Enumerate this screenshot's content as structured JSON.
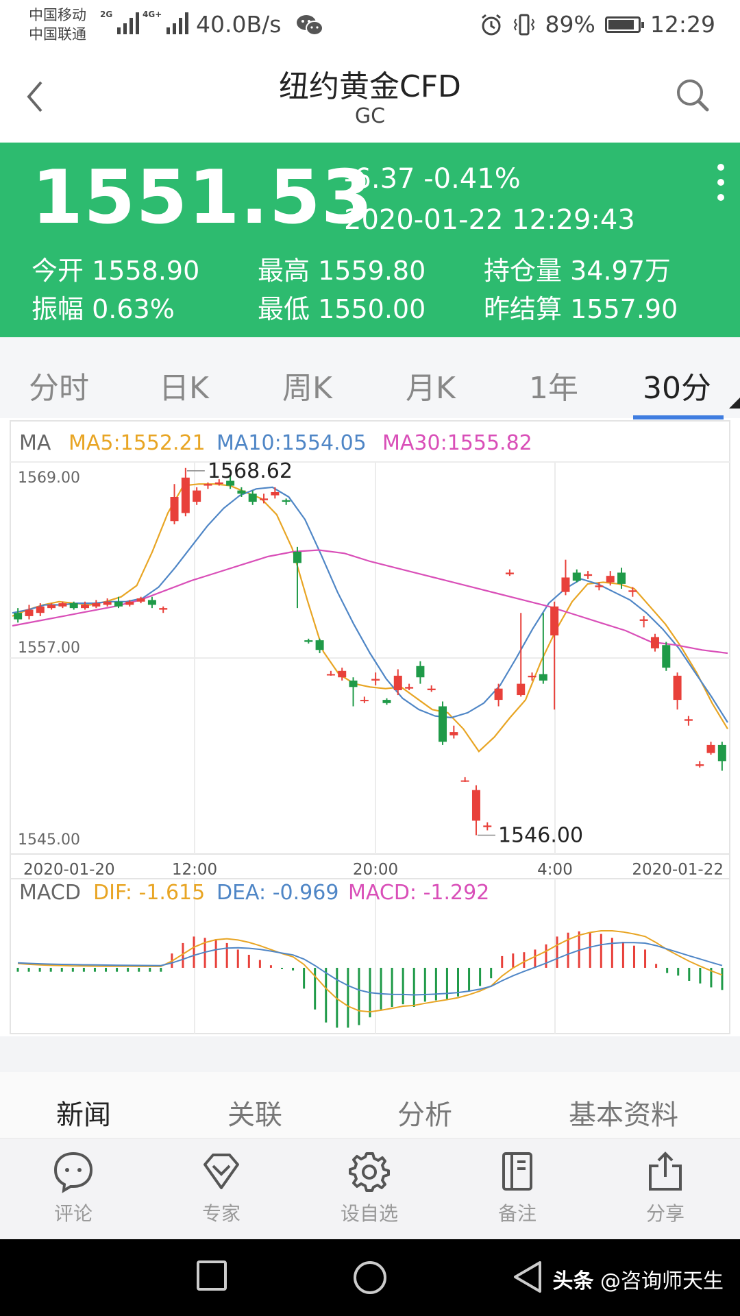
{
  "status_bar": {
    "carrier_1": "中国移动",
    "carrier_2": "中国联通",
    "signal_1_tag": "2G",
    "signal_2_tag": "4G+",
    "net_speed": "40.0B/s",
    "battery": "89%",
    "time": "12:29",
    "icons": [
      "wechat-icon",
      "alarm-icon",
      "vibrate-icon",
      "battery-icon"
    ]
  },
  "header": {
    "title": "纽约黄金CFD",
    "symbol": "GC",
    "icons": [
      "back-arrow-icon",
      "search-icon"
    ]
  },
  "quote": {
    "price": "1551.53",
    "change": "-6.37 -0.41%",
    "datetime": "2020-01-22 12:29:43",
    "background": "#2dbb6f",
    "stats": [
      {
        "label": "今开",
        "value": "1558.90"
      },
      {
        "label": "最高",
        "value": "1559.80"
      },
      {
        "label": "持仓量",
        "value": "34.97万"
      },
      {
        "label": "振幅",
        "value": "0.63%"
      },
      {
        "label": "最低",
        "value": "1550.00"
      },
      {
        "label": "昨结算",
        "value": "1557.90"
      }
    ]
  },
  "period_tabs": {
    "items": [
      "分时",
      "日K",
      "周K",
      "月K",
      "1年",
      "30分"
    ],
    "active": "30分",
    "accent": "#3f7de0"
  },
  "ma_legend": {
    "label": "MA",
    "ma5": "MA5:1552.21",
    "ma10": "MA10:1554.05",
    "ma30": "MA30:1555.82",
    "colors": {
      "ma5": "#e8a524",
      "ma10": "#4f86c6",
      "ma30": "#d94fb8"
    }
  },
  "macd_legend": {
    "label": "MACD",
    "dif": "DIF: -1.615",
    "dea": "DEA: -0.969",
    "macd": "MACD: -1.292"
  },
  "chart_data": [
    {
      "type": "candlestick",
      "interval": "30分",
      "y_tick_labels": [
        "1569.00",
        "1557.00",
        "1545.00"
      ],
      "ylim": [
        1545.0,
        1569.0
      ],
      "x_tick_labels": [
        "2020-01-20",
        "12:00",
        "20:00",
        "4:00",
        "2020-01-22"
      ],
      "annotations": [
        {
          "text": "1568.62",
          "value": 1568.62
        },
        {
          "text": "1546.00",
          "value": 1546.0
        }
      ],
      "up_color": "#e8403a",
      "down_color": "#1f9a48",
      "candles": [
        {
          "o": 1559.8,
          "c": 1559.4,
          "h": 1560.1,
          "l": 1559.2
        },
        {
          "o": 1559.6,
          "c": 1560.0,
          "h": 1560.3,
          "l": 1559.4
        },
        {
          "o": 1559.8,
          "c": 1560.2,
          "h": 1560.4,
          "l": 1559.6
        },
        {
          "o": 1560.1,
          "c": 1560.3,
          "h": 1560.4,
          "l": 1560.0
        },
        {
          "o": 1560.2,
          "c": 1560.4,
          "h": 1560.5,
          "l": 1560.1
        },
        {
          "o": 1560.4,
          "c": 1560.1,
          "h": 1560.5,
          "l": 1560.0
        },
        {
          "o": 1560.1,
          "c": 1560.3,
          "h": 1560.5,
          "l": 1560.0
        },
        {
          "o": 1560.2,
          "c": 1560.4,
          "h": 1560.6,
          "l": 1560.1
        },
        {
          "o": 1560.3,
          "c": 1560.5,
          "h": 1560.7,
          "l": 1560.2
        },
        {
          "o": 1560.5,
          "c": 1560.2,
          "h": 1560.8,
          "l": 1560.1
        },
        {
          "o": 1560.3,
          "c": 1560.5,
          "h": 1560.6,
          "l": 1560.2
        },
        {
          "o": 1560.5,
          "c": 1560.7,
          "h": 1560.8,
          "l": 1560.4
        },
        {
          "o": 1560.6,
          "c": 1560.3,
          "h": 1560.8,
          "l": 1560.1
        },
        {
          "o": 1560.0,
          "c": 1560.1,
          "h": 1560.2,
          "l": 1559.8
        },
        {
          "o": 1565.5,
          "c": 1567.0,
          "h": 1567.8,
          "l": 1565.3
        },
        {
          "o": 1566.0,
          "c": 1568.2,
          "h": 1568.8,
          "l": 1565.8
        },
        {
          "o": 1566.7,
          "c": 1567.4,
          "h": 1567.6,
          "l": 1566.5
        },
        {
          "o": 1567.7,
          "c": 1567.8,
          "h": 1567.9,
          "l": 1567.5
        },
        {
          "o": 1567.8,
          "c": 1567.9,
          "h": 1568.1,
          "l": 1567.7
        },
        {
          "o": 1568.0,
          "c": 1567.7,
          "h": 1568.4,
          "l": 1567.5
        },
        {
          "o": 1567.4,
          "c": 1567.2,
          "h": 1567.6,
          "l": 1567.0
        },
        {
          "o": 1567.2,
          "c": 1566.7,
          "h": 1567.4,
          "l": 1566.5
        },
        {
          "o": 1566.8,
          "c": 1566.9,
          "h": 1567.2,
          "l": 1566.6
        },
        {
          "o": 1567.1,
          "c": 1567.3,
          "h": 1567.6,
          "l": 1566.9
        },
        {
          "o": 1566.8,
          "c": 1566.7,
          "h": 1566.9,
          "l": 1566.5
        },
        {
          "o": 1563.6,
          "c": 1562.9,
          "h": 1563.9,
          "l": 1560.1
        },
        {
          "o": 1558.1,
          "c": 1558.0,
          "h": 1558.2,
          "l": 1557.9
        },
        {
          "o": 1558.1,
          "c": 1557.5,
          "h": 1558.2,
          "l": 1557.3
        },
        {
          "o": 1556.0,
          "c": 1556.0,
          "h": 1556.2,
          "l": 1555.9
        },
        {
          "o": 1555.8,
          "c": 1556.2,
          "h": 1556.4,
          "l": 1555.6
        },
        {
          "o": 1555.6,
          "c": 1555.2,
          "h": 1555.8,
          "l": 1554.0
        },
        {
          "o": 1554.4,
          "c": 1554.4,
          "h": 1554.6,
          "l": 1554.2
        },
        {
          "o": 1555.6,
          "c": 1555.7,
          "h": 1556.1,
          "l": 1555.3
        },
        {
          "o": 1554.4,
          "c": 1554.2,
          "h": 1554.5,
          "l": 1554.1
        },
        {
          "o": 1555.0,
          "c": 1555.9,
          "h": 1556.3,
          "l": 1554.7
        },
        {
          "o": 1555.1,
          "c": 1555.2,
          "h": 1555.4,
          "l": 1555.0
        },
        {
          "o": 1556.5,
          "c": 1555.8,
          "h": 1556.8,
          "l": 1555.4
        },
        {
          "o": 1555.0,
          "c": 1555.1,
          "h": 1555.3,
          "l": 1554.9
        },
        {
          "o": 1554.0,
          "c": 1551.8,
          "h": 1554.3,
          "l": 1551.6
        },
        {
          "o": 1552.2,
          "c": 1552.4,
          "h": 1552.8,
          "l": 1552.0
        },
        {
          "o": 1549.4,
          "c": 1549.4,
          "h": 1549.6,
          "l": 1549.3
        },
        {
          "o": 1546.9,
          "c": 1548.8,
          "h": 1549.1,
          "l": 1546.0
        },
        {
          "o": 1546.5,
          "c": 1546.6,
          "h": 1546.8,
          "l": 1546.3
        },
        {
          "o": 1554.4,
          "c": 1555.1,
          "h": 1555.4,
          "l": 1554.0
        },
        {
          "o": 1562.2,
          "c": 1562.3,
          "h": 1562.5,
          "l": 1562.1
        },
        {
          "o": 1554.7,
          "c": 1555.4,
          "h": 1559.8,
          "l": 1554.6
        },
        {
          "o": 1555.8,
          "c": 1555.9,
          "h": 1556.1,
          "l": 1555.6
        },
        {
          "o": 1556.0,
          "c": 1555.6,
          "h": 1559.8,
          "l": 1555.4
        },
        {
          "o": 1558.4,
          "c": 1560.2,
          "h": 1560.5,
          "l": 1553.8
        },
        {
          "o": 1561.1,
          "c": 1562.0,
          "h": 1563.1,
          "l": 1560.9
        },
        {
          "o": 1562.3,
          "c": 1561.8,
          "h": 1562.5,
          "l": 1561.7
        },
        {
          "o": 1562.1,
          "c": 1562.2,
          "h": 1562.4,
          "l": 1561.9
        },
        {
          "o": 1561.4,
          "c": 1561.5,
          "h": 1561.7,
          "l": 1561.2
        },
        {
          "o": 1561.7,
          "c": 1562.1,
          "h": 1562.4,
          "l": 1561.5
        },
        {
          "o": 1562.3,
          "c": 1561.6,
          "h": 1562.6,
          "l": 1561.3
        },
        {
          "o": 1561.1,
          "c": 1561.2,
          "h": 1561.4,
          "l": 1560.8
        },
        {
          "o": 1559.3,
          "c": 1559.4,
          "h": 1559.6,
          "l": 1558.9
        },
        {
          "o": 1557.6,
          "c": 1558.3,
          "h": 1558.5,
          "l": 1557.4
        },
        {
          "o": 1557.8,
          "c": 1556.4,
          "h": 1558.0,
          "l": 1556.2
        },
        {
          "o": 1554.4,
          "c": 1555.9,
          "h": 1556.1,
          "l": 1553.8
        },
        {
          "o": 1553.1,
          "c": 1553.2,
          "h": 1553.4,
          "l": 1552.8
        },
        {
          "o": 1550.3,
          "c": 1550.4,
          "h": 1550.6,
          "l": 1550.2
        },
        {
          "o": 1551.1,
          "c": 1551.6,
          "h": 1551.8,
          "l": 1551.0
        },
        {
          "o": 1551.6,
          "c": 1550.6,
          "h": 1551.8,
          "l": 1550.0
        }
      ],
      "ma_lines": [
        {
          "name": "MA5",
          "color": "#e8a524",
          "values": [
            1559.6,
            1560.0,
            1560.3,
            1560.5,
            1560.4,
            1560.3,
            1560.5,
            1560.8,
            1561.5,
            1563.6,
            1566.0,
            1567.7,
            1567.8,
            1567.8,
            1567.7,
            1567.3,
            1566.9,
            1565.9,
            1563.8,
            1560.5,
            1557.4,
            1556.0,
            1555.4,
            1555.2,
            1555.1,
            1555.2,
            1554.5,
            1553.8,
            1553.6,
            1552.6,
            1551.2,
            1552.1,
            1553.3,
            1554.4,
            1556.8,
            1558.8,
            1560.5,
            1561.6,
            1561.7,
            1561.6,
            1561.3,
            1560.2,
            1559.1,
            1557.7,
            1556.1,
            1554.2,
            1552.6
          ]
        },
        {
          "name": "MA10",
          "color": "#4f86c6",
          "values": [
            1559.8,
            1560.0,
            1560.3,
            1560.3,
            1560.4,
            1560.4,
            1560.5,
            1560.5,
            1560.7,
            1561.4,
            1562.6,
            1563.9,
            1565.2,
            1566.3,
            1567.1,
            1567.5,
            1567.6,
            1567.0,
            1565.6,
            1563.4,
            1561.1,
            1559.1,
            1557.3,
            1555.7,
            1554.5,
            1553.8,
            1553.4,
            1553.3,
            1553.6,
            1554.2,
            1555.3,
            1557.0,
            1558.8,
            1560.4,
            1561.3,
            1561.9,
            1561.6,
            1561.1,
            1560.6,
            1559.8,
            1558.8,
            1557.6,
            1556.1,
            1554.6,
            1553.0
          ]
        },
        {
          "name": "MA30",
          "color": "#d94fb8",
          "values": [
            1559.0,
            1559.3,
            1559.6,
            1559.9,
            1560.2,
            1560.6,
            1561.2,
            1561.8,
            1562.3,
            1562.8,
            1563.3,
            1563.6,
            1563.7,
            1563.5,
            1563.0,
            1562.6,
            1562.2,
            1561.8,
            1561.4,
            1561.0,
            1560.6,
            1560.2,
            1559.7,
            1559.2,
            1558.7,
            1558.0,
            1557.8,
            1557.5,
            1557.3
          ]
        }
      ]
    },
    {
      "type": "macd",
      "series": [
        {
          "name": "DIF",
          "color": "#e8a524"
        },
        {
          "name": "DEA",
          "color": "#4f86c6"
        },
        {
          "name": "MACD",
          "color": "#d94fb8"
        }
      ],
      "latest": {
        "DIF": -1.615,
        "DEA": -0.969,
        "MACD": -1.292
      },
      "histogram": [
        -0.15,
        -0.15,
        -0.15,
        -0.15,
        -0.15,
        -0.15,
        -0.15,
        -0.15,
        -0.15,
        -0.15,
        -0.15,
        -0.15,
        -0.15,
        -0.15,
        0.55,
        0.95,
        1.2,
        1.15,
        1.1,
        0.95,
        0.7,
        0.5,
        0.3,
        0.1,
        -0.05,
        -0.1,
        -0.8,
        -1.6,
        -2.1,
        -2.3,
        -2.3,
        -2.2,
        -1.9,
        -1.6,
        -1.5,
        -1.4,
        -1.5,
        -1.3,
        -1.25,
        -1.2,
        -1.1,
        -0.9,
        -0.7,
        -0.4,
        0.45,
        0.55,
        0.6,
        0.7,
        0.9,
        1.2,
        1.35,
        1.4,
        1.35,
        1.3,
        1.15,
        1.0,
        0.85,
        0.7,
        0.15,
        -0.2,
        -0.3,
        -0.5,
        -0.6,
        -0.75,
        -0.85
      ]
    }
  ],
  "info_tabs": {
    "items": [
      "新闻",
      "关联",
      "分析",
      "基本资料"
    ],
    "active": "新闻"
  },
  "toolbar": [
    {
      "label": "评论",
      "icon": "comment-icon"
    },
    {
      "label": "专家",
      "icon": "expert-icon"
    },
    {
      "label": "设自选",
      "icon": "settings-icon"
    },
    {
      "label": "备注",
      "icon": "note-icon"
    },
    {
      "label": "分享",
      "icon": "share-icon"
    }
  ],
  "navbar": {
    "icons": [
      "recent-apps-icon",
      "home-icon",
      "back-icon"
    ],
    "watermark_app": "头条",
    "watermark_user": "@咨询师天生"
  }
}
